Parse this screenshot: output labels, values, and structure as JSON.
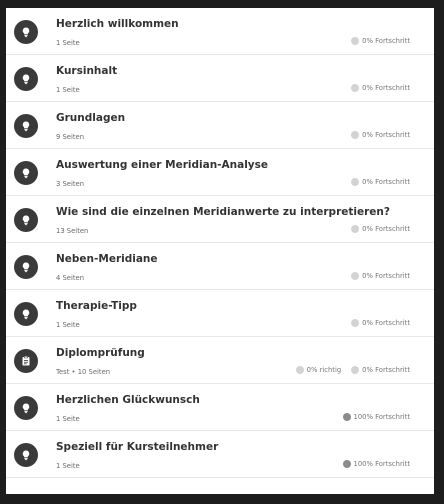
{
  "modules": [
    {
      "icon": "lightbulb-icon",
      "title": "Herzlich willkommen",
      "subtitle": "1 Seite",
      "progress": "0% Fortschritt",
      "progress_value": 0
    },
    {
      "icon": "lightbulb-icon",
      "title": "Kursinhalt",
      "subtitle": "1 Seite",
      "progress": "0% Fortschritt",
      "progress_value": 0
    },
    {
      "icon": "lightbulb-icon",
      "title": "Grundlagen",
      "subtitle": "9 Seiten",
      "progress": "0% Fortschritt",
      "progress_value": 0
    },
    {
      "icon": "lightbulb-icon",
      "title": "Auswertung einer Meridian-Analyse",
      "subtitle": "3 Seiten",
      "progress": "0% Fortschritt",
      "progress_value": 0
    },
    {
      "icon": "lightbulb-icon",
      "title": "Wie sind die einzelnen Meridianwerte zu interpretieren?",
      "subtitle": "13 Seiten",
      "progress": "0% Fortschritt",
      "progress_value": 0
    },
    {
      "icon": "lightbulb-icon",
      "title": "Neben-Meridiane",
      "subtitle": "4 Seiten",
      "progress": "0% Fortschritt",
      "progress_value": 0
    },
    {
      "icon": "lightbulb-icon",
      "title": "Therapie-Tipp",
      "subtitle": "1 Seite",
      "progress": "0% Fortschritt",
      "progress_value": 0
    },
    {
      "icon": "exam-icon",
      "title": "Diplomprüfung",
      "subtitle": "Test • 10 Seiten",
      "score": "0% richtig",
      "progress": "0% Fortschritt",
      "progress_value": 0
    },
    {
      "icon": "lightbulb-icon",
      "title": "Herzlichen Glückwunsch",
      "subtitle": "1 Seite",
      "progress": "100% Fortschritt",
      "progress_value": 100
    },
    {
      "icon": "lightbulb-icon",
      "title": "Speziell für Kursteilnehmer",
      "subtitle": "1 Seite",
      "progress": "100% Fortschritt",
      "progress_value": 100
    }
  ]
}
